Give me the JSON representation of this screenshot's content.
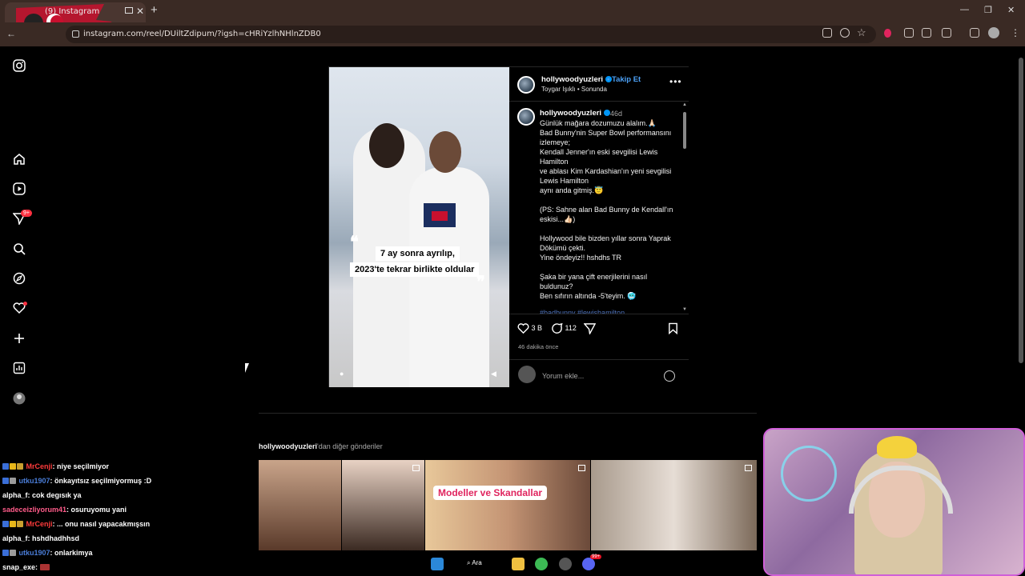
{
  "browser": {
    "tab_title": "(9) Instagram",
    "url": "instagram.com/reel/DUiltZdipum/?igsh=cHRiYzlhNHlnZDB0"
  },
  "post": {
    "username": "hollywoodyuzleri",
    "follow_label": "Takip Et",
    "subtitle": "Toygar Işıklı • Sonunda",
    "video_caption_line1": "7 ay sonra ayrılıp,",
    "video_caption_line2": "2023'te tekrar birlikte oldular",
    "comment_time": "46d",
    "comment_body": "Günlük mağara dozumuzu alalım.🙏🏻\nBad Bunny'nin Super Bowl performansını izlemeye;\nKendall Jenner'ın eski sevgilisi Lewis Hamilton\nve ablası Kim Kardashian'ın yeni sevgilisi Lewis Hamilton\naynı anda gitmiş.😇\n\n(PS: Sahne alan Bad Bunny de Kendall'ın eskisi...👍🏻)\n\nHollywood bile bizden yıllar sonra Yaprak Dökümü çekti.\nYine öndeyiz!! hshdhs TR\n\nŞaka bir yana çift enerjilerini nasıl buldunuz?\nBen sıfırın altında -5'teyim. 🥶",
    "comment_tags": "#badbunny #lewishamilton",
    "likes": "3 B",
    "comments": "112",
    "posted_ago": "46 dakika önce",
    "add_comment_placeholder": "Yorum ekle..."
  },
  "more_posts": {
    "account": "hollywoodyuzleri",
    "suffix": "'dan diğer gönderiler",
    "thumb_label": "Modeller ve Skandallar"
  },
  "chat": [
    {
      "user": "MrCenji",
      "color": "#ff3b3b",
      "message": ": niye seçilmiyor"
    },
    {
      "user": "utku1907",
      "color": "#4a7dd8",
      "message": ": önkayıtsız seçilmiyormuş :D"
    },
    {
      "user": "alpha_f",
      "color": "#ffffff",
      "message": ": cok degısık ya"
    },
    {
      "user": "sadeceizliyorum41",
      "color": "#ff5c8a",
      "message": ": osuruyomu yani"
    },
    {
      "user": "MrCenji",
      "color": "#ff3b3b",
      "message": ": ... onu nasıl yapacakmışsın"
    },
    {
      "user": "alpha_f",
      "color": "#ffffff",
      "message": ": hshdhadhhsd"
    },
    {
      "user": "utku1907",
      "color": "#4a7dd8",
      "message": ": onlarkimya"
    },
    {
      "user": "snap_exe",
      "color": "#ffffff",
      "message": ":"
    }
  ],
  "taskbar": {
    "search_label": "Ara",
    "discord_badge": "99+"
  },
  "sidebar": {
    "notif_badge": "9+"
  },
  "colors": {
    "accent_blue": "#0095f6",
    "notification_red": "#ff3040",
    "browser_chrome": "#3a2a24"
  }
}
